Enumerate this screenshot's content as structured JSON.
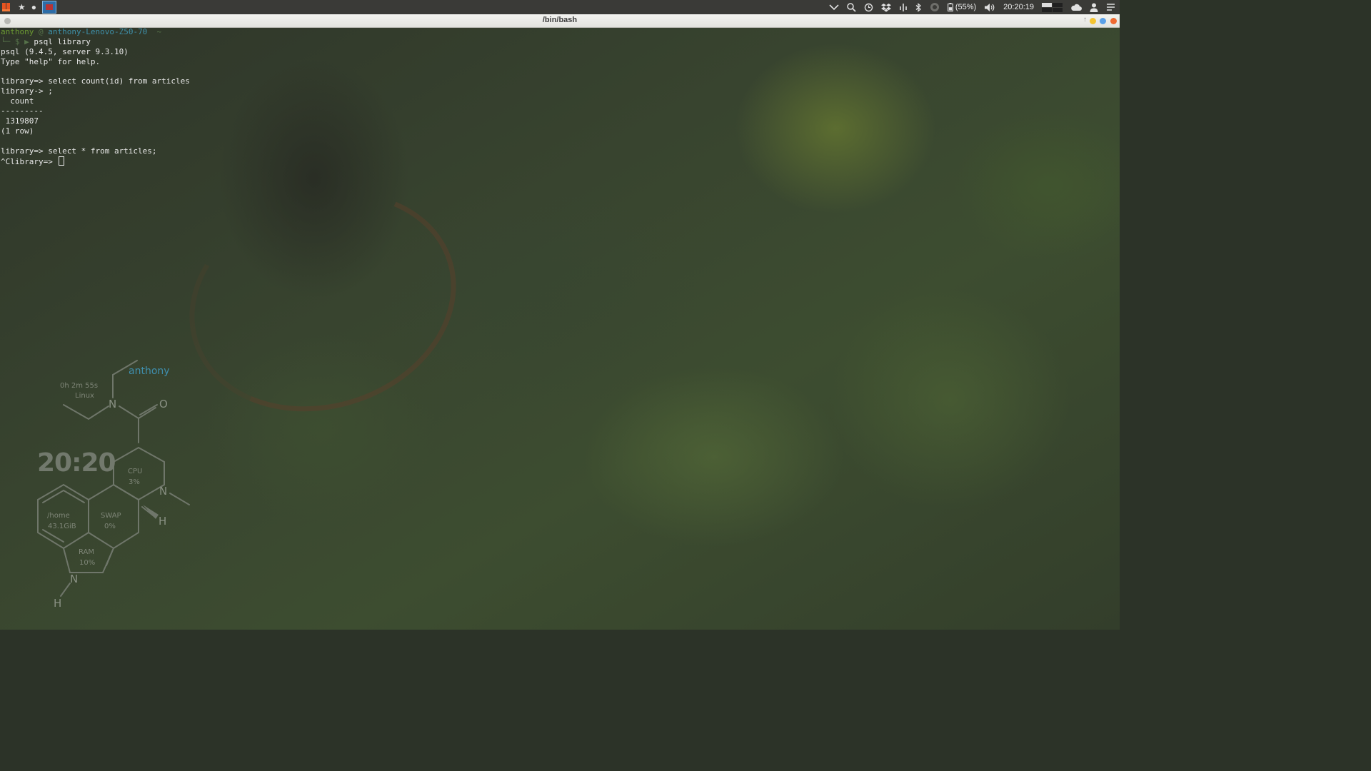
{
  "top_panel": {
    "left_icons": [
      "ubuntu-logo-icon",
      "star-icon",
      "record-icon",
      "terminal-app-icon"
    ],
    "right_icons": [
      "chevron-down-icon",
      "search-icon",
      "history-icon",
      "dropbox-icon",
      "network-icon",
      "bluetooth-icon",
      "ring-icon",
      "battery-icon"
    ],
    "battery": "(55%)",
    "volume_icon": "volume-icon",
    "clock": "20:20:19",
    "tray_icons": [
      "cloud-icon",
      "user-icon",
      "menu-icon"
    ],
    "colors": {
      "panel": "#3a3a37",
      "active_app": "#2d6da8"
    }
  },
  "terminal": {
    "title": "/bin/bash",
    "prompt": {
      "user": "anthony",
      "at": " @ ",
      "host": "anthony-Lenovo-Z50-70",
      "dir": "  ~",
      "branch": "└─ $ ▶ ",
      "command": "psql library"
    },
    "lines": [
      "psql (9.4.5, server 9.3.10)",
      "Type \"help\" for help.",
      "",
      "library=> select count(id) from articles",
      "library-> ;",
      "  count",
      "---------",
      " 1319807",
      "(1 row)",
      "",
      "library=> select * from articles;"
    ],
    "last_prompt": "^Clibrary=> ",
    "colors": {
      "user": "#6b9a32",
      "host": "#3e8fa8",
      "text": "#e8e8e8"
    }
  },
  "conky": {
    "username": "anthony",
    "uptime": "0h 2m 55s",
    "os": "Linux",
    "time": "20:20",
    "cpu_label": "CPU",
    "cpu_value": "3%",
    "home_label": "/home",
    "home_value": "43.1GiB",
    "swap_label": "SWAP",
    "swap_value": "0%",
    "ram_label": "RAM",
    "ram_value": "10%",
    "atoms": {
      "n_top": "N",
      "o": "O",
      "n_ring": "N",
      "h_ring": "H",
      "n_bottom": "N",
      "h_bottom": "H"
    }
  }
}
